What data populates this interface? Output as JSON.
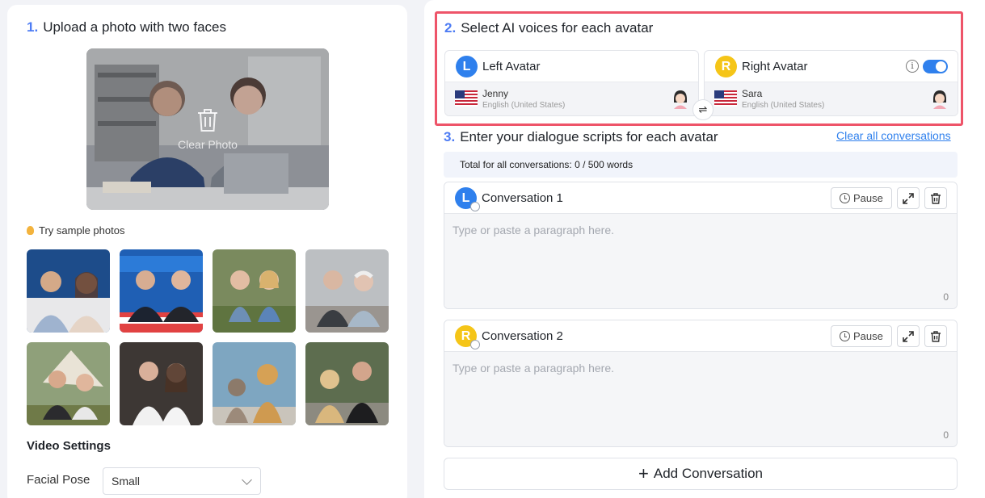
{
  "step1": {
    "number": "1.",
    "title": "Upload a photo with two faces",
    "clear_photo_label": "Clear Photo"
  },
  "samples": {
    "title": "Try sample photos"
  },
  "video_settings": {
    "title": "Video Settings",
    "facial_pose_label": "Facial Pose",
    "facial_pose_value": "Small"
  },
  "step2": {
    "number": "2.",
    "title": "Select AI voices for each avatar",
    "left": {
      "badge": "L",
      "name": "Left Avatar",
      "voice": "Jenny",
      "language": "English (United States)"
    },
    "right": {
      "badge": "R",
      "name": "Right Avatar",
      "voice": "Sara",
      "language": "English (United States)"
    },
    "swap_symbol": "⇌",
    "info_symbol": "i"
  },
  "step3": {
    "number": "3.",
    "title": "Enter your dialogue scripts for each avatar",
    "clear_all": "Clear all conversations",
    "total": "Total for all conversations: 0 / 500 words"
  },
  "conversations": [
    {
      "badge": "L",
      "title": "Conversation 1",
      "pause": "Pause",
      "placeholder": "Type or paste a paragraph here.",
      "count": "0"
    },
    {
      "badge": "R",
      "title": "Conversation 2",
      "pause": "Pause",
      "placeholder": "Type or paste a paragraph here.",
      "count": "0"
    }
  ],
  "add_conversation": {
    "plus": "+",
    "label": "Add Conversation"
  },
  "colors": {
    "accent": "#2f80ed",
    "step_number": "#4d7cf4",
    "highlight_border": "#ee5469",
    "right_badge": "#f5c518"
  }
}
